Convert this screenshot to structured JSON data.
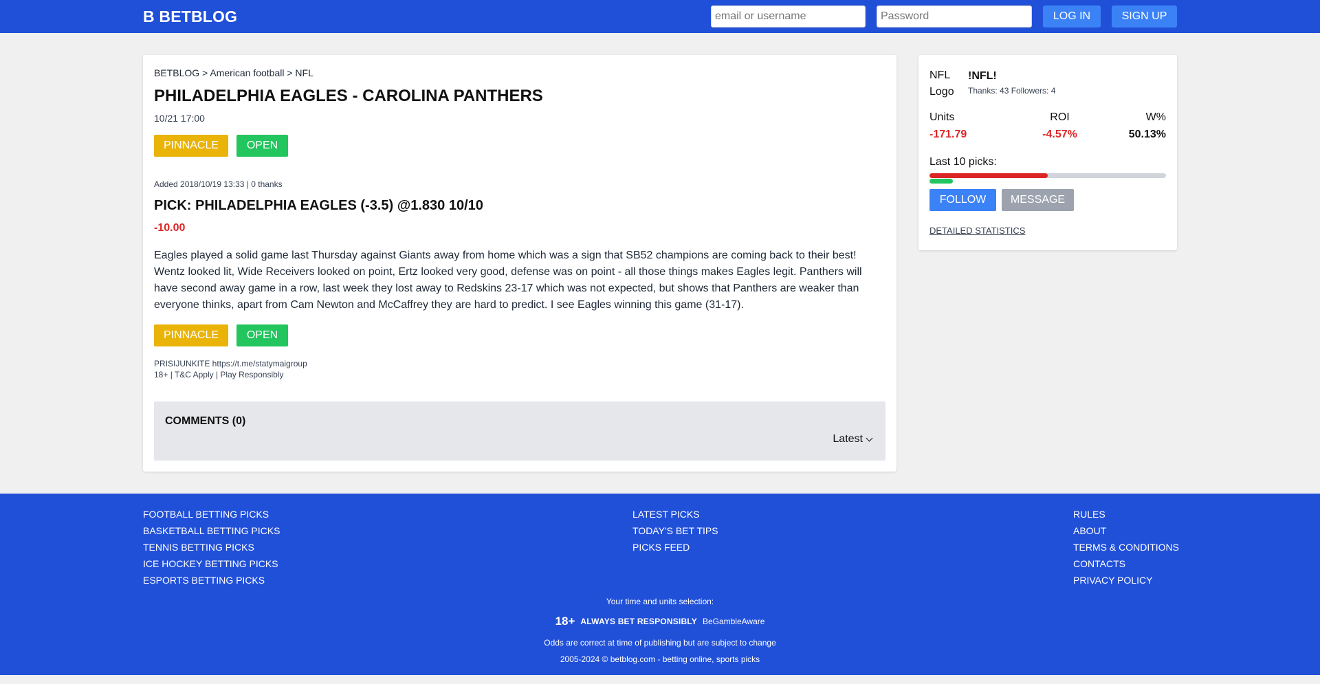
{
  "header": {
    "logo": "B BETBLOG",
    "username_placeholder": "email or username",
    "password_placeholder": "Password",
    "login_label": "LOG IN",
    "signup_label": "SIGN UP"
  },
  "post": {
    "breadcrumb": "BETBLOG > American football > NFL",
    "title": "PHILADELPHIA EAGLES - CAROLINA PANTHERS",
    "datetime": "10/21 17:00",
    "bookmaker_label": "PINNACLE",
    "open_label": "OPEN",
    "added": "Added 2018/10/19 13:33 | 0 thanks",
    "pick": "PICK: PHILADELPHIA EAGLES (-3.5) @1.830 10/10",
    "result_units": "-10.00",
    "description": "Eagles played a solid game last Thursday against Giants away from home which was a sign that SB52 champions are coming back to their best! Wentz looked lit, Wide Receivers looked on point, Ertz looked very good, defense was on point - all those things makes Eagles legit. Panthers will have second away game in a row, last week they lost away to Redskins 23-17 which was not expected, but shows that Panthers are weaker than everyone thinks, apart from Cam Newton and McCaffrey they are hard to predict. I see Eagles winning this game (31-17).",
    "promo_line1": "PRISIJUNKITE https://t.me/statymaigroup",
    "promo_line2": "18+ | T&C Apply | Play Responsibly",
    "comments_title": "COMMENTS (0)",
    "sort_label": "Latest"
  },
  "tipster": {
    "logo_alt": "NFL Logo",
    "name": "!NFL!",
    "meta": "Thanks: 43 Followers: 4",
    "units_label": "Units",
    "units_value": "-171.79",
    "roi_label": "ROI",
    "roi_value": "-4.57%",
    "win_label": "W%",
    "win_value": "50.13%",
    "last10_label": "Last 10 picks:",
    "last10_loss_fraction": 0.5,
    "last10_win_fraction": 0.1,
    "follow_label": "FOLLOW",
    "message_label": "MESSAGE",
    "detailed_label": "DETAILED STATISTICS"
  },
  "footer": {
    "col1": [
      "FOOTBALL BETTING PICKS",
      "BASKETBALL BETTING PICKS",
      "TENNIS BETTING PICKS",
      "ICE HOCKEY BETTING PICKS",
      "ESPORTS BETTING PICKS"
    ],
    "col2": [
      "LATEST PICKS",
      "TODAY'S BET TIPS",
      "PICKS FEED"
    ],
    "col3": [
      "RULES",
      "ABOUT",
      "TERMS & CONDITIONS",
      "CONTACTS",
      "PRIVACY POLICY"
    ],
    "selection": "Your time and units selection:",
    "age": "18+",
    "always_bet": "ALWAYS BET RESPONSIBLY",
    "begambleaware": "BeGambleAware",
    "odds_note": "Odds are correct at time of publishing but are subject to change",
    "copyright": "2005-2024 © betblog.com - betting online, sports picks"
  },
  "colors": {
    "brand_blue": "#2150d8",
    "button_blue": "#3b82f6",
    "pinnacle_yellow": "#eab308",
    "open_green": "#22c55e",
    "negative_red": "#dc2626"
  }
}
